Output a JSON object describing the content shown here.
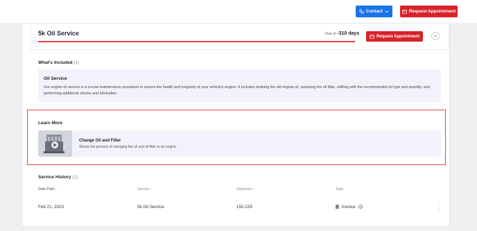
{
  "topbar": {
    "contact_label": "Contact",
    "request_label": "Request Appointment"
  },
  "service": {
    "title": "5k Oil Service",
    "due_prefix": "Due in",
    "due_value": "-310 days",
    "request_label": "Request Appointment",
    "progress_fraction": 1.0
  },
  "included": {
    "heading": "What's Included",
    "count": "(1)",
    "item_title": "Oil Service",
    "item_desc": "Our engine oil service is a crucial maintenance procedure to ensure the health and longevity of your vehicle's engine. It includes draining the old engine oil, replacing the oil filter, refilling with the recommended oil type and quantity, and performing additional checks and lubrication."
  },
  "learn": {
    "heading": "Learn More",
    "video_title": "Change Oil and Filter",
    "video_desc": "Shows the process of changing the oil and oil filter in an engine."
  },
  "history": {
    "heading": "Service History",
    "count": "(1)",
    "columns": [
      "Date Paid",
      "Service",
      "Odometer",
      "Type"
    ],
    "rows": [
      {
        "date": "Feb 21, 2023",
        "service": "5k Oil Service",
        "odometer": "150,229",
        "type": "Invoice"
      }
    ]
  },
  "colors": {
    "accent_red": "#d8232a",
    "accent_blue": "#1b74e8",
    "highlight_frame": "#e0463e"
  }
}
